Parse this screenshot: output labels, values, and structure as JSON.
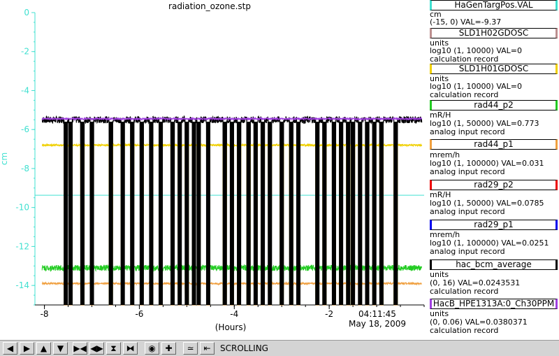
{
  "title": "radiation_ozone.stp",
  "timestamp": {
    "time": "04:11:45",
    "date": "May 18, 2009"
  },
  "toolbar": {
    "buttons": [
      "◀",
      "▶",
      "▲",
      "▼",
      "▶◀",
      "◀▶",
      "⧗",
      "⧓",
      "◉",
      "✚",
      "≃",
      "⇤"
    ],
    "status": "SCROLLING"
  },
  "legend": [
    {
      "name": "HaGenTargPos.VAL",
      "units": "cm",
      "range": "(-15, 0) VAL=-9.37",
      "record": "",
      "color": "#40e0d0"
    },
    {
      "name": "SLD1H02GDOSC",
      "units": "units",
      "range": "log10 (1, 10000) VAL=0",
      "record": "calculation record",
      "color": "#bc8f8f"
    },
    {
      "name": "SLD1H01GDOSC",
      "units": "units",
      "range": "log10 (1, 10000) VAL=0",
      "record": "calculation record",
      "color": "#f0d000"
    },
    {
      "name": "rad44_p2",
      "units": "mR/H",
      "range": "log10 (1, 50000) VAL=0.773",
      "record": "analog input record",
      "color": "#22cc22"
    },
    {
      "name": "rad44_p1",
      "units": "mrem/h",
      "range": "log10 (1, 100000) VAL=0.031",
      "record": "analog input record",
      "color": "#f0a040"
    },
    {
      "name": "rad29_p2",
      "units": "mR/H",
      "range": "log10 (1, 50000) VAL=0.0785",
      "record": "analog input record",
      "color": "#ee0000"
    },
    {
      "name": "rad29_p1",
      "units": "mrem/h",
      "range": "log10 (1, 100000) VAL=0.0251",
      "record": "analog input record",
      "color": "#0000ee"
    },
    {
      "name": "hac_bcm_average",
      "units": "units",
      "range": "(0, 16) VAL=0.0243531",
      "record": "calculation record",
      "color": "#000000"
    },
    {
      "name": "HacB_HPE1313A:0_Ch30PPM",
      "units": "units",
      "range": "(0, 0.06) VAL=0.0380371",
      "record": "calculation record",
      "color": "#a040e0"
    }
  ],
  "chart_data": {
    "type": "line",
    "title": "radiation_ozone.stp",
    "xlabel": "(Hours)",
    "ylabel": "cm",
    "xlim": [
      -8.2,
      0
    ],
    "ylim": [
      -15,
      0
    ],
    "x_ticks": [
      -8,
      -6,
      -4,
      -2
    ],
    "y_ticks": [
      0,
      -2,
      -4,
      -6,
      -8,
      -10,
      -12,
      -14
    ],
    "grid": false,
    "series": [
      {
        "name": "HaGenTargPos.VAL",
        "color": "#40e0d0",
        "level": -9.37,
        "dropouts": false
      },
      {
        "name": "hac_bcm_average",
        "color": "#000000",
        "level": -5.5,
        "dropouts": true
      },
      {
        "name": "HacB_HPE1313A:0_Ch30PPM",
        "color": "#a040e0",
        "level": -5.45,
        "dropouts": false
      },
      {
        "name": "SLD1H01GDOSC",
        "color": "#f0d000",
        "level": -6.8,
        "dropouts": true
      },
      {
        "name": "rad44_p2",
        "color": "#22cc22",
        "level": -13.1,
        "dropouts": true
      },
      {
        "name": "rad44_p1",
        "color": "#f0a040",
        "level": -13.9,
        "dropouts": true
      }
    ],
    "dropout_hours": [
      -7.55,
      -7.45,
      -7.2,
      -7.0,
      -6.6,
      -6.35,
      -6.15,
      -5.95,
      -5.75,
      -5.55,
      -5.3,
      -5.15,
      -5.0,
      -4.85,
      -4.75,
      -4.55,
      -4.2,
      -4.05,
      -3.9,
      -3.7,
      -3.55,
      -3.4,
      -3.25,
      -3.0,
      -2.8,
      -2.65,
      -2.25,
      -2.1,
      -1.9,
      -1.75,
      -1.6,
      -1.5,
      -1.35,
      -1.2,
      -1.05,
      -0.9,
      -0.6
    ]
  }
}
